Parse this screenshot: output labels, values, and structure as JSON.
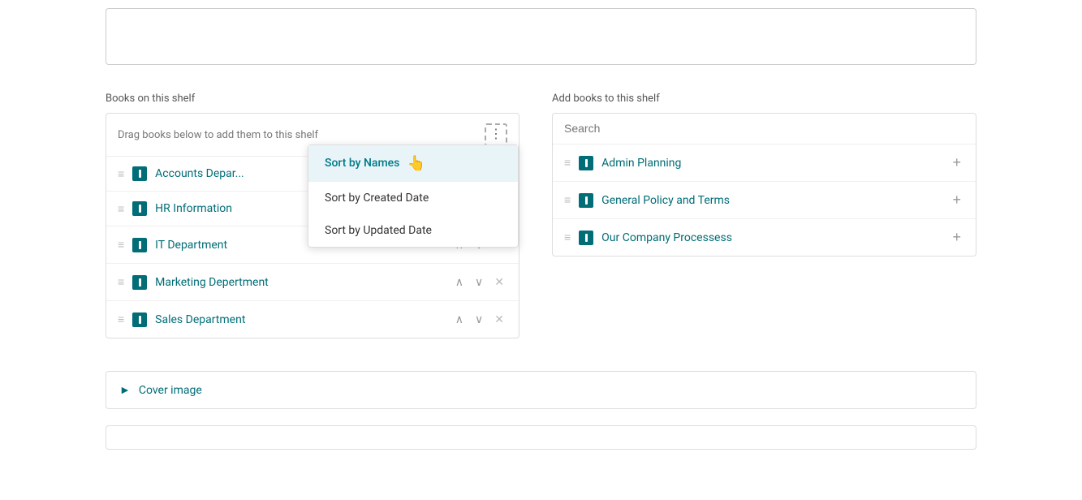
{
  "top_textarea": {
    "value": ""
  },
  "left_panel": {
    "label": "Books on this shelf",
    "drag_hint": "Drag books below to add them to this shelf",
    "menu_button_label": "⋮",
    "dropdown": {
      "items": [
        {
          "id": "sort-name",
          "label": "Sort by Names",
          "active": true
        },
        {
          "id": "sort-created",
          "label": "Sort by Created Date",
          "active": false
        },
        {
          "id": "sort-updated",
          "label": "Sort by Updated Date",
          "active": false
        }
      ]
    },
    "books": [
      {
        "id": "book-1",
        "name": "Accounts Depar..."
      },
      {
        "id": "book-2",
        "name": "HR Information"
      },
      {
        "id": "book-3",
        "name": "IT Department"
      },
      {
        "id": "book-4",
        "name": "Marketing Depertment"
      },
      {
        "id": "book-5",
        "name": "Sales Department"
      }
    ]
  },
  "right_panel": {
    "label": "Add books to this shelf",
    "search_placeholder": "Search",
    "books": [
      {
        "id": "rbook-1",
        "name": "Admin Planning"
      },
      {
        "id": "rbook-2",
        "name": "General Policy and Terms"
      },
      {
        "id": "rbook-3",
        "name": "Our Company Processess"
      }
    ]
  },
  "cover_image": {
    "label": "Cover image"
  },
  "row_actions": {
    "up": "∧",
    "down": "∨",
    "close": "✕"
  },
  "drag_handle_char": "≡",
  "plus_char": "+"
}
